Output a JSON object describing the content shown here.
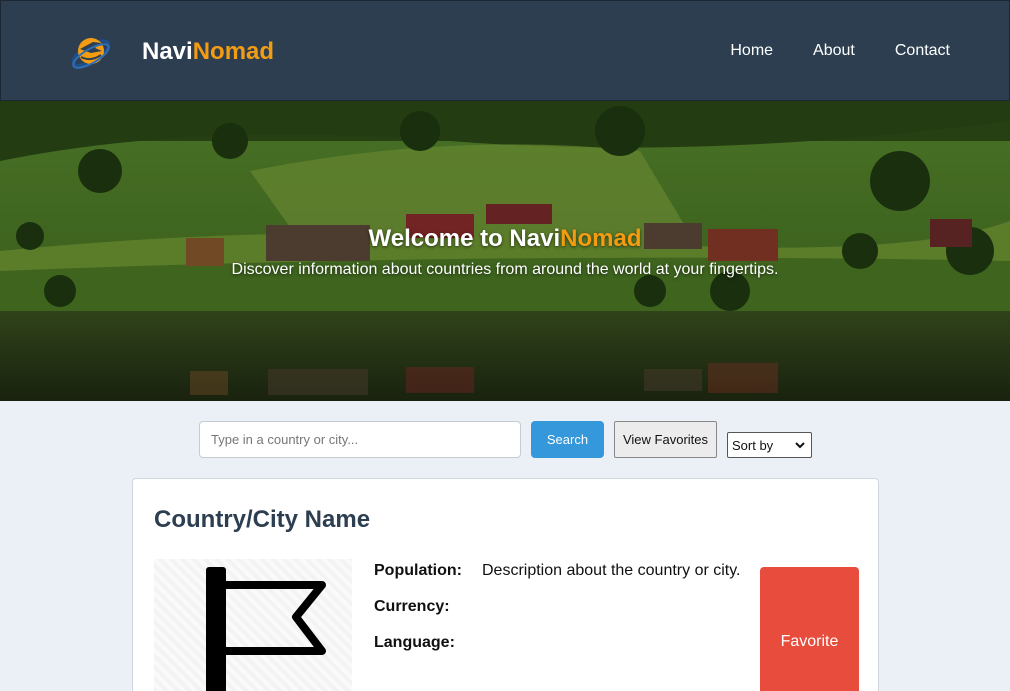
{
  "header": {
    "brand_part1": "Navi",
    "brand_part2": "Nomad",
    "nav": [
      "Home",
      "About",
      "Contact"
    ]
  },
  "hero": {
    "title_part1": "Welcome to Navi",
    "title_part2": "Nomad",
    "subtitle": "Discover information about countries from around the world at your fingertips."
  },
  "search": {
    "placeholder": "Type in a country or city...",
    "search_label": "Search",
    "favorites_label": "View Favorites",
    "sort_selected": "Sort by"
  },
  "card": {
    "title": "Country/City Name",
    "population_label": "Population:",
    "currency_label": "Currency:",
    "language_label": "Language:",
    "description": "Description about the country or city.",
    "favorite_label": "Favorite"
  },
  "colors": {
    "header_bg": "#2c3e50",
    "accent": "#f39c12",
    "primary": "#3498db",
    "danger": "#e74c3c",
    "page_bg": "#eaf0f6"
  },
  "icons": [
    "logo-icon",
    "flag-icon",
    "chevron-down-icon"
  ]
}
